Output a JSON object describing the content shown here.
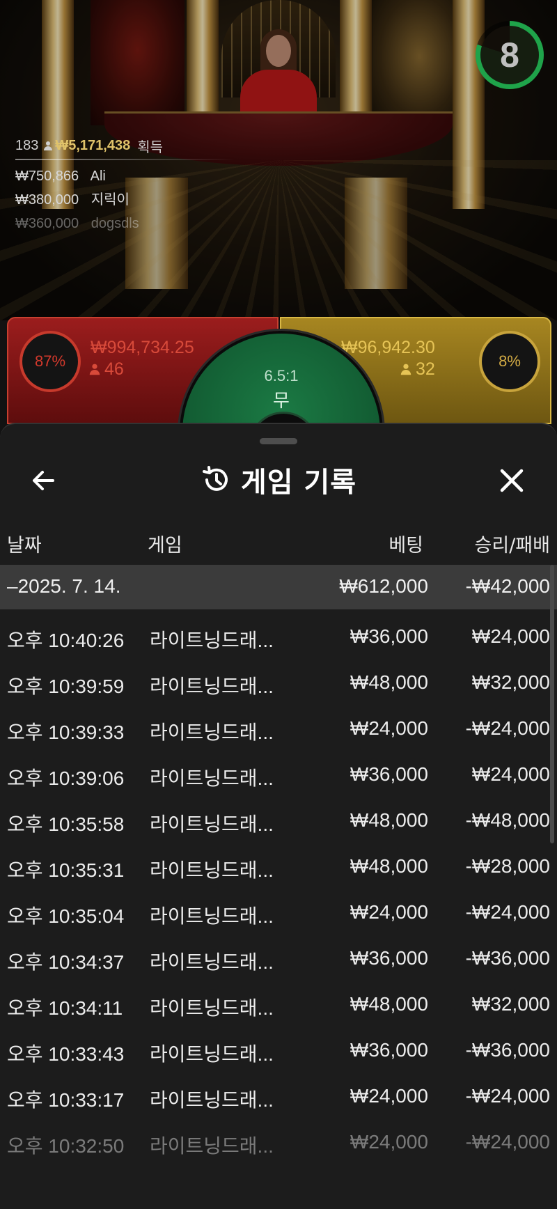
{
  "timer": {
    "value": "8"
  },
  "win_summary": {
    "players": "183",
    "amount": "₩5,171,438",
    "label": "획득"
  },
  "winners": [
    {
      "amount": "₩750,866",
      "name": "Ali"
    },
    {
      "amount": "₩380,000",
      "name": "지릭이"
    },
    {
      "amount": "₩360,000",
      "name": "dogsdls"
    }
  ],
  "bets": {
    "dragon": {
      "percent": "87%",
      "amount": "₩994,734.25",
      "players": "46"
    },
    "tiger": {
      "percent": "8%",
      "amount": "₩96,942.30",
      "players": "32"
    },
    "tie": {
      "odds": "6.5:1",
      "label": "무"
    }
  },
  "history": {
    "title": "게임 기록",
    "columns": {
      "date": "날짜",
      "game": "게임",
      "bet": "베팅",
      "win": "승리/패배"
    },
    "date_group": {
      "date": "–2025. 7. 14.",
      "bet": "₩612,000",
      "win": "-₩42,000"
    },
    "rows": [
      {
        "time": "오후 10:40:26",
        "game": "라이트닝드래...",
        "bet": "₩36,000",
        "win": "₩24,000"
      },
      {
        "time": "오후 10:39:59",
        "game": "라이트닝드래...",
        "bet": "₩48,000",
        "win": "₩32,000"
      },
      {
        "time": "오후 10:39:33",
        "game": "라이트닝드래...",
        "bet": "₩24,000",
        "win": "-₩24,000"
      },
      {
        "time": "오후 10:39:06",
        "game": "라이트닝드래...",
        "bet": "₩36,000",
        "win": "₩24,000"
      },
      {
        "time": "오후 10:35:58",
        "game": "라이트닝드래...",
        "bet": "₩48,000",
        "win": "-₩48,000"
      },
      {
        "time": "오후 10:35:31",
        "game": "라이트닝드래...",
        "bet": "₩48,000",
        "win": "-₩28,000"
      },
      {
        "time": "오후 10:35:04",
        "game": "라이트닝드래...",
        "bet": "₩24,000",
        "win": "-₩24,000"
      },
      {
        "time": "오후 10:34:37",
        "game": "라이트닝드래...",
        "bet": "₩36,000",
        "win": "-₩36,000"
      },
      {
        "time": "오후 10:34:11",
        "game": "라이트닝드래...",
        "bet": "₩48,000",
        "win": "₩32,000"
      },
      {
        "time": "오후 10:33:43",
        "game": "라이트닝드래...",
        "bet": "₩36,000",
        "win": "-₩36,000"
      },
      {
        "time": "오후 10:33:17",
        "game": "라이트닝드래...",
        "bet": "₩24,000",
        "win": "-₩24,000"
      },
      {
        "time": "오후 10:32:50",
        "game": "라이트닝드래...",
        "bet": "₩24,000",
        "win": "-₩24,000"
      }
    ]
  },
  "icons": {
    "back": "arrow-left-icon",
    "history": "history-clock-icon",
    "close": "close-icon"
  },
  "colors": {
    "dragon": "#9b1d1d",
    "tiger": "#a78621",
    "tie": "#1b7a44",
    "timer": "#1fa34a",
    "sheet": "#1c1c1c",
    "date_row": "#3b3b3b"
  }
}
